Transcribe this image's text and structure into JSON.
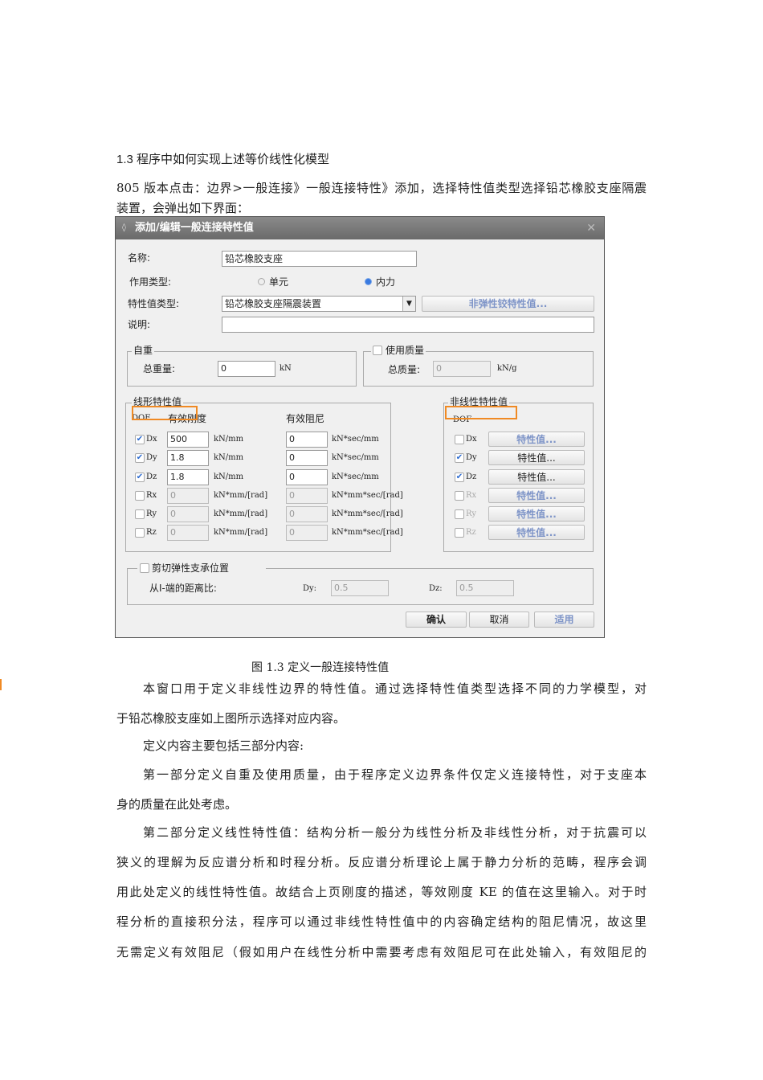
{
  "heading": "1.3 程序中如何实现上述等价线性化模型",
  "intro": [
    "805 版本点击：边界>一般连接》一般连接特性》添加，选择特性值类型选择铅芯橡胶支座隔震",
    "装置，会弹出如下界面："
  ],
  "dialog": {
    "title": "添加/编辑一般连接特性值",
    "name_label": "名称:",
    "name_value": "铅芯橡胶支座",
    "action_label": "作用类型:",
    "radio_element": "单元",
    "radio_force": "内力",
    "type_label": "特性值类型:",
    "type_value": "铅芯橡胶支座隔震装置",
    "hinge_button": "非弹性铰特性值...",
    "desc_label": "说明:",
    "self_weight": {
      "legend": "自重",
      "label": "总重量:",
      "value": "0",
      "unit": "kN"
    },
    "mass": {
      "legend": "使用质量",
      "label": "总质量:",
      "value": "0",
      "unit": "kN/g"
    },
    "linear": {
      "legend": "线形特性值",
      "dof": "DOF",
      "stiff": "有效刚度",
      "damp": "有效阻尼",
      "rows": [
        {
          "dof": "Dx",
          "checked": true,
          "k": "500",
          "ku": "kN/mm",
          "c": "0",
          "cu": "kN*sec/mm"
        },
        {
          "dof": "Dy",
          "checked": true,
          "k": "1.8",
          "ku": "kN/mm",
          "c": "0",
          "cu": "kN*sec/mm"
        },
        {
          "dof": "Dz",
          "checked": true,
          "k": "1.8",
          "ku": "kN/mm",
          "c": "0",
          "cu": "kN*sec/mm"
        },
        {
          "dof": "Rx",
          "checked": false,
          "k": "0",
          "ku": "kN*mm/[rad]",
          "c": "0",
          "cu": "kN*mm*sec/[rad]"
        },
        {
          "dof": "Ry",
          "checked": false,
          "k": "0",
          "ku": "kN*mm/[rad]",
          "c": "0",
          "cu": "kN*mm*sec/[rad]"
        },
        {
          "dof": "Rz",
          "checked": false,
          "k": "0",
          "ku": "kN*mm/[rad]",
          "c": "0",
          "cu": "kN*mm*sec/[rad]"
        }
      ]
    },
    "nonlinear": {
      "legend": "非线性特性值",
      "dof": "DOF",
      "rows": [
        {
          "dof": "Dx",
          "checked": false,
          "btn": "特性值..."
        },
        {
          "dof": "Dy",
          "checked": true,
          "btn": "特性值..."
        },
        {
          "dof": "Dz",
          "checked": true,
          "btn": "特性值..."
        },
        {
          "dof": "Rx",
          "checked": false,
          "btn": "特性值..."
        },
        {
          "dof": "Ry",
          "checked": false,
          "btn": "特性值..."
        },
        {
          "dof": "Rz",
          "checked": false,
          "btn": "特性值..."
        }
      ]
    },
    "shear": {
      "legend": "剪切弹性支承位置",
      "ratio_label": "从I-端的距离比:",
      "dy_label": "Dy:",
      "dy": "0.5",
      "dz_label": "Dz:",
      "dz": "0.5"
    },
    "ok": "确认",
    "cancel": "取消",
    "apply": "适用"
  },
  "caption": "图 1.3 定义一般连接特性值",
  "body": [
    "本窗口用于定义非线性边界的特性值。通过选择特性值类型选择不同的力学模型，对",
    "于铅芯橡胶支座如上图所示选择对应内容。",
    "定义内容主要包括三部分内容:",
    "第一部分定义自重及使用质量，由于程序定义边界条件仅定义连接特性，对于支座本",
    "身的质量在此处考虑。",
    "第二部分定义线性特性值：结构分析一般分为线性分析及非线性分析，对于抗震可以",
    "狭义的理解为反应谱分析和时程分析。反应谱分析理论上属于静力分析的范畴，程序会调",
    "用此处定义的线性特性值。故结合上页刚度的描述，等效刚度 KE 的值在这里输入。对于时",
    "程分析的直接积分法，程序可以通过非线性特性值中的内容确定结构的阻尼情况，故这里",
    "无需定义有效阻尼（假如用户在线性分析中需要考虑有效阻尼可在此处输入，有效阻尼的"
  ]
}
